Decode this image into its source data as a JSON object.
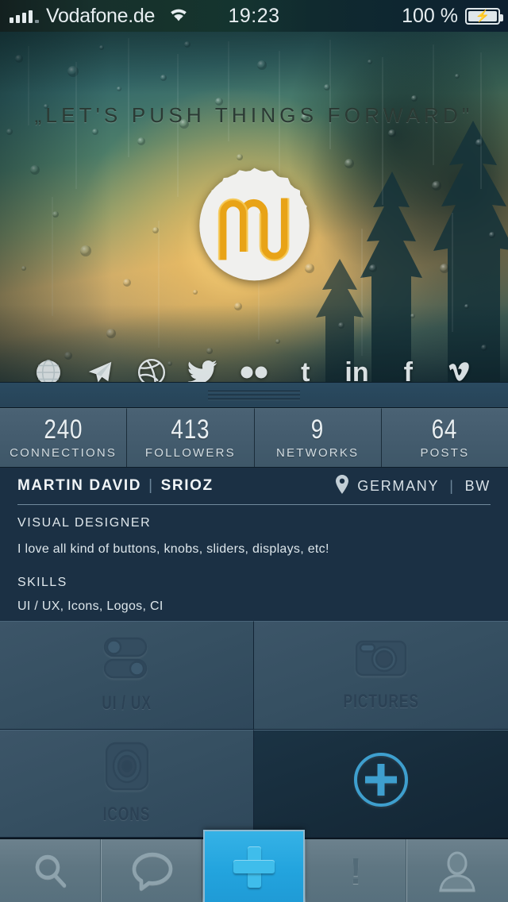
{
  "statusbar": {
    "carrier": "Vodafone.de",
    "time": "19:23",
    "battery_percent": "100 %",
    "signal_icon": "signal-bars-icon",
    "wifi_icon": "wifi-icon",
    "battery_icon": "battery-charging-icon"
  },
  "hero": {
    "tagline": "„LET'S PUSH THINGS FORWARD\"",
    "logo_text": "md",
    "logo_color": "#e8a317",
    "socials": [
      {
        "name": "website",
        "icon": "globe-icon"
      },
      {
        "name": "send",
        "icon": "paper-plane-icon"
      },
      {
        "name": "dribbble",
        "icon": "dribbble-icon"
      },
      {
        "name": "twitter",
        "icon": "twitter-icon"
      },
      {
        "name": "flickr",
        "icon": "flickr-icon"
      },
      {
        "name": "tumblr",
        "icon": "tumblr-icon",
        "glyph": "t"
      },
      {
        "name": "linkedin",
        "icon": "linkedin-icon",
        "glyph": "in"
      },
      {
        "name": "facebook",
        "icon": "facebook-icon",
        "glyph": "f"
      },
      {
        "name": "vimeo",
        "icon": "vimeo-icon",
        "glyph": "v"
      }
    ]
  },
  "handle": {
    "name": "drag-handle"
  },
  "stats": [
    {
      "value": "240",
      "label": "CONNECTIONS"
    },
    {
      "value": "413",
      "label": "FOLLOWERS"
    },
    {
      "value": "9",
      "label": "NETWORKS"
    },
    {
      "value": "64",
      "label": "POSTS"
    }
  ],
  "profile": {
    "name": "MARTIN DAVID",
    "name_separator": "|",
    "handle": "SRIOZ",
    "location_icon": "location-pin-icon",
    "country": "GERMANY",
    "location_separator": "|",
    "region": "BW",
    "role": "VISUAL DESIGNER",
    "bio": "I love all kind of buttons, knobs, sliders, displays, etc!",
    "skills_heading": "SKILLS",
    "skills": "UI / UX, Icons, Logos, CI"
  },
  "tiles": [
    {
      "label": "UI / UX",
      "icon": "toggle-switches-icon"
    },
    {
      "label": "PICTURES",
      "icon": "camera-icon"
    },
    {
      "label": "ICONS",
      "icon": "target-rings-icon"
    },
    {
      "label": "",
      "icon": "plus-circle-icon"
    }
  ],
  "tabbar": [
    {
      "name": "search",
      "icon": "search-icon"
    },
    {
      "name": "messages",
      "icon": "speech-bubble-icon"
    },
    {
      "name": "add",
      "icon": "plus-icon",
      "accent": "#23a4de"
    },
    {
      "name": "notifications",
      "icon": "exclamation-icon",
      "glyph": "!"
    },
    {
      "name": "profile",
      "icon": "person-icon"
    }
  ],
  "colors": {
    "accent_blue": "#23a4de",
    "panel_dark": "#1b3044",
    "stat_slate": "#445c6e",
    "tabbar_gray": "#5f7682"
  }
}
